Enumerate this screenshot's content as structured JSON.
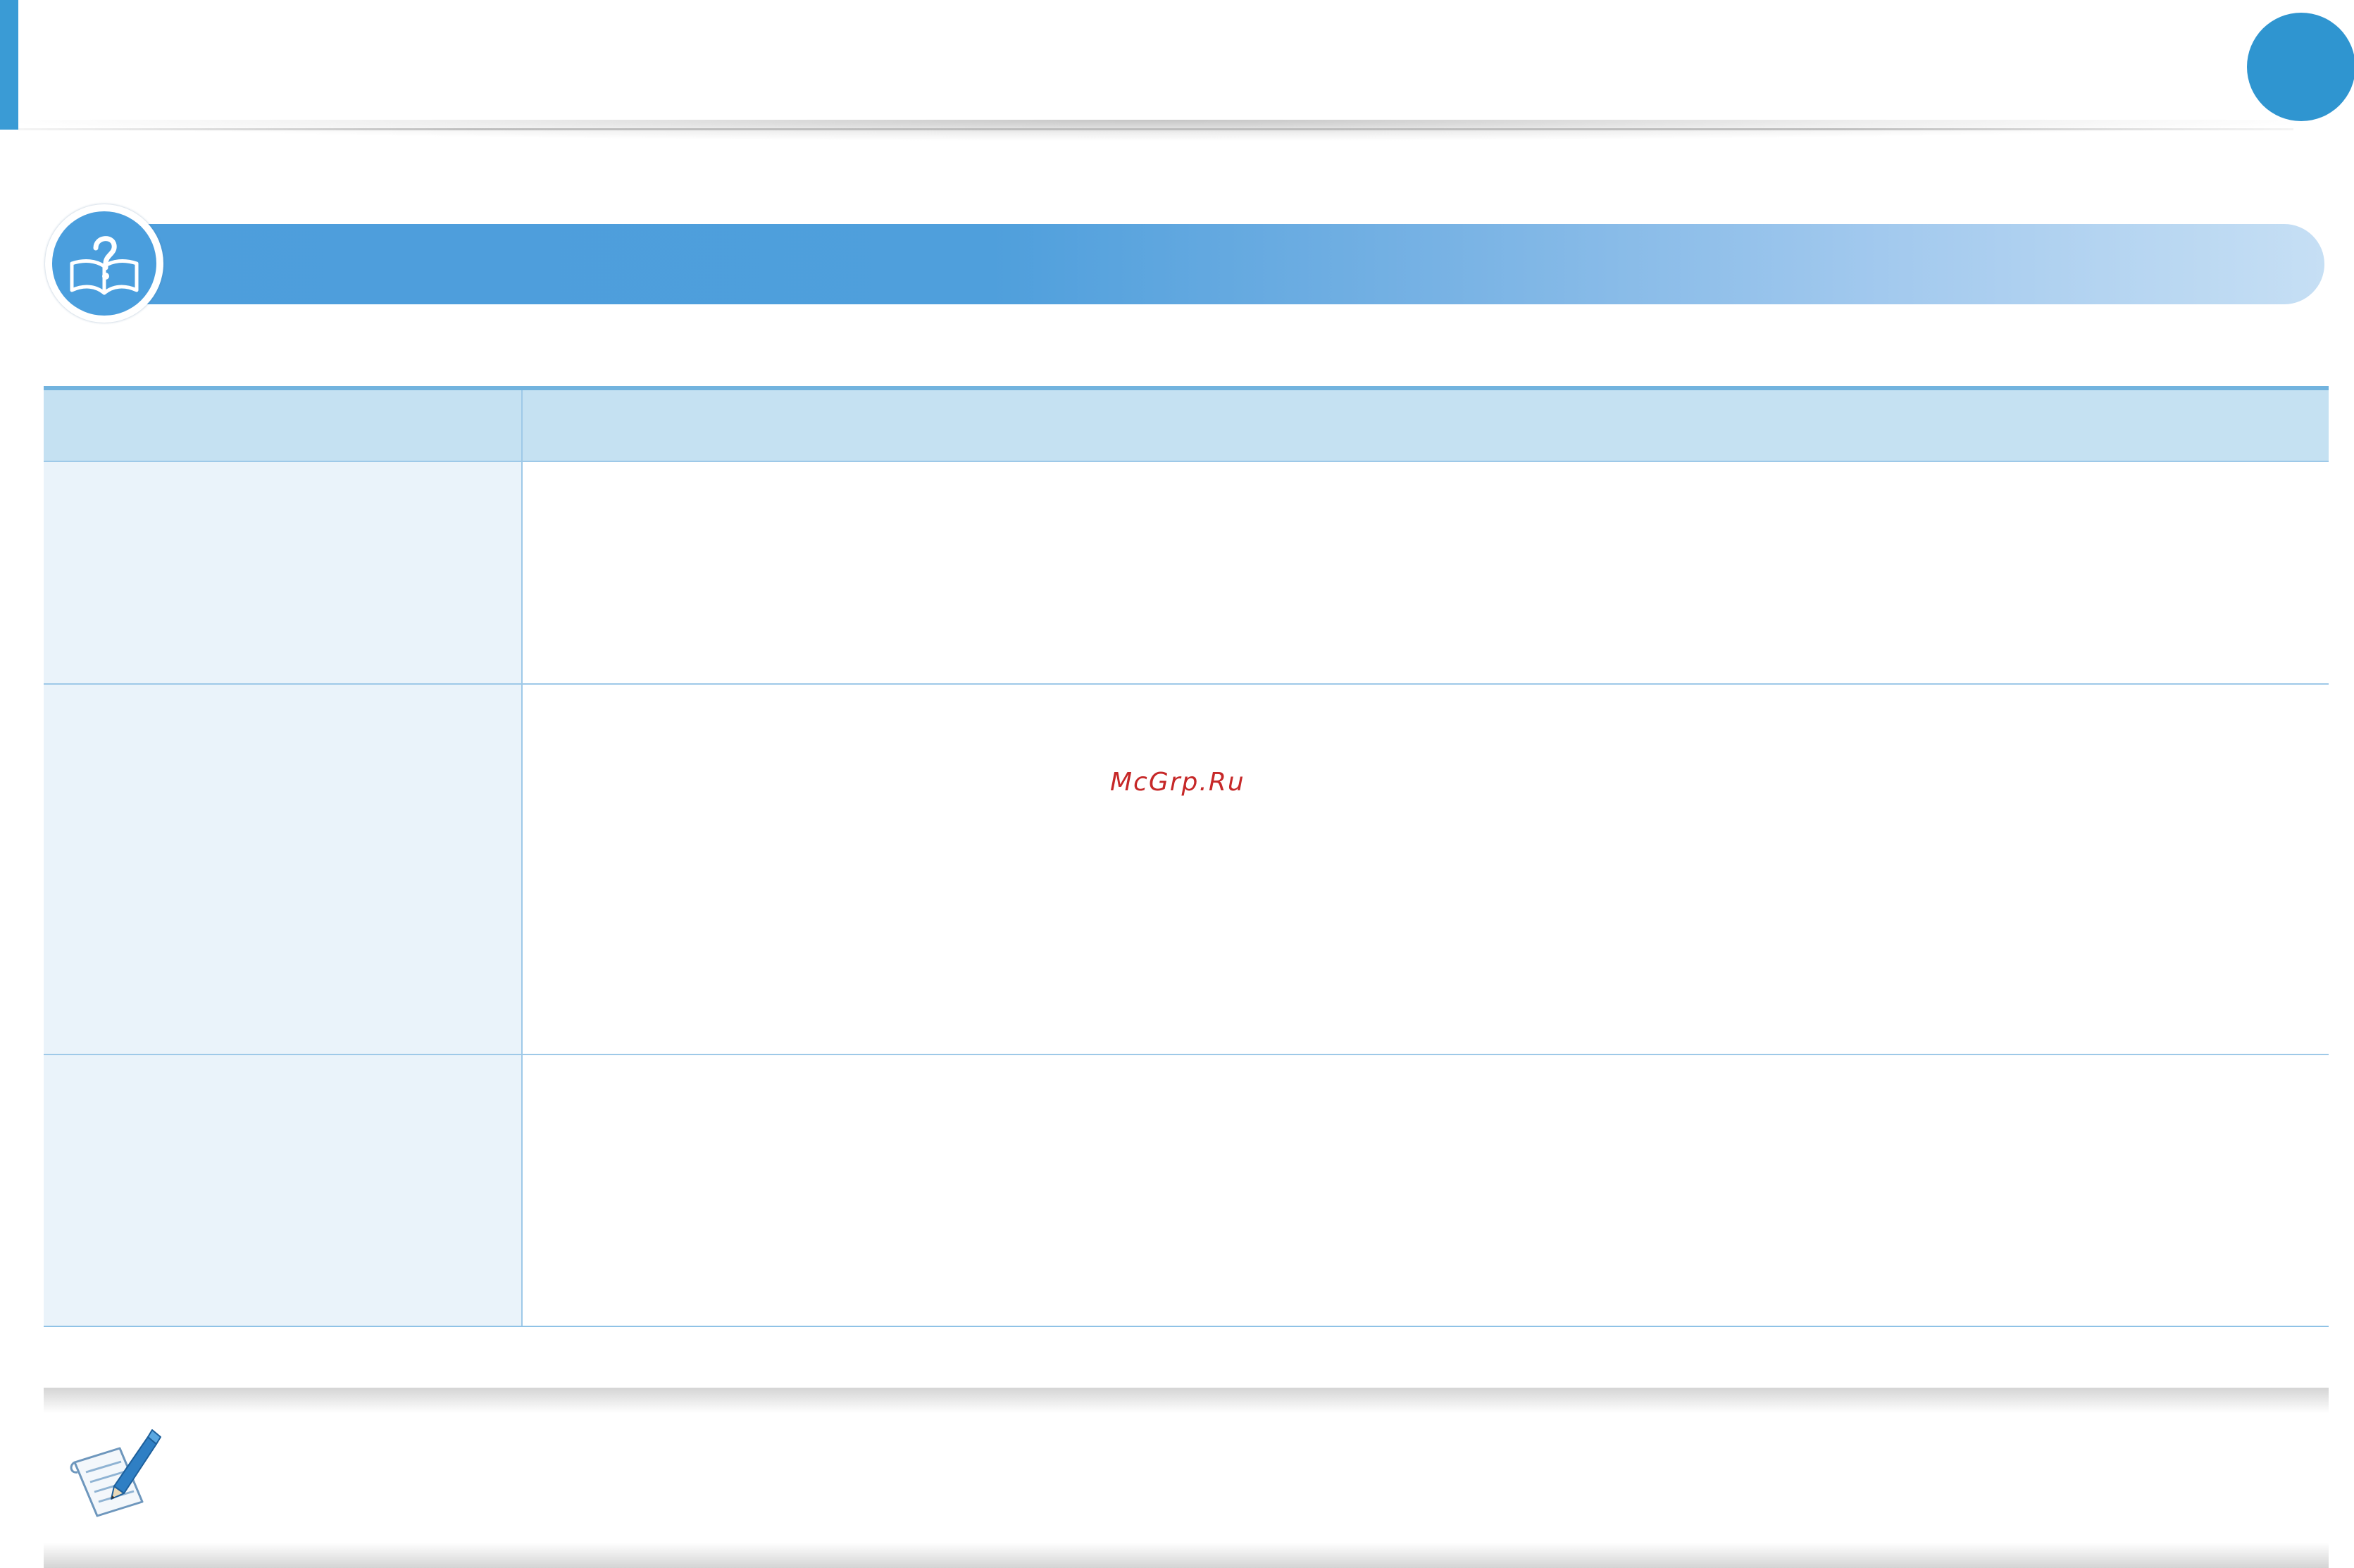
{
  "page": {
    "accent_color": "#3a9bd5",
    "page_marker_color": "#2f95d0"
  },
  "section_banner": {
    "icon": "help-book-icon",
    "title": "",
    "gradient_start": "#4d9edc",
    "gradient_end": "#c6dff4"
  },
  "table": {
    "header_color": "#c5e1f2",
    "row_label_color": "#eaf3fa",
    "border_color": "#72b3de",
    "headers": [
      "",
      ""
    ],
    "rows": [
      {
        "label": "",
        "content": ""
      },
      {
        "label": "",
        "content": ""
      },
      {
        "label": "",
        "content": ""
      }
    ]
  },
  "watermark": {
    "text": "McGrp.Ru",
    "color": "#c62828"
  },
  "note": {
    "icon": "note-pencil-icon",
    "text": ""
  }
}
